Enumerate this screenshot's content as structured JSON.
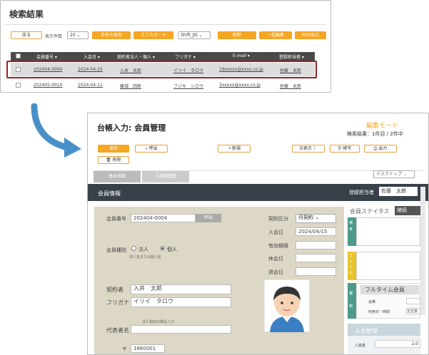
{
  "search": {
    "title": "検索結果",
    "back_label": "戻る",
    "count_label": "表示件数",
    "count_value": "20",
    "save_cond_label": "条件の保存",
    "export_label": "エクスポート",
    "encoding_value": "Shift_JIS",
    "delete_label": "削除",
    "bulk_edit_label": "一括編集",
    "pdf_label": "PDF出力",
    "columns": [
      "会員番号 ▾",
      "入会日 ▾",
      "契約者法人・個人 ▾",
      "フリガナ ▾",
      "E-mail ▾",
      "登録担当者 ▾"
    ],
    "rows": [
      [
        "202404-0004",
        "2024-04-15",
        "入井　太郎",
        "イリイ　タロウ",
        "19xxxxx@xxxx.co.jp",
        "佐藤　太郎"
      ],
      [
        "202405-0010",
        "2024-04-11",
        "藤城　四郎",
        "フジキ　シロウ",
        "3xxxxx@xxxx.co.jp",
        "佐藤　太郎"
      ]
    ]
  },
  "ledger": {
    "title": "台帳入力: 会員管理",
    "mode": "編集モード",
    "result_info": "検索結果：1件目 / 2件中",
    "buttons": {
      "save": "保存",
      "call": "呼出",
      "new": "＋新規",
      "next": "次表示 〉",
      "book": "帳写",
      "print": "出力",
      "delete": "削除"
    },
    "tabs": [
      "基本画面",
      "入退期履歴"
    ],
    "device": "デスクトップ",
    "section_title": "会員情報",
    "staff_label": "登録担当者",
    "staff_value": "佐藤　太郎",
    "member_no_label": "会員番号",
    "member_no_value": "202404-0004",
    "call_small": "呼出",
    "member_type_label": "会員種別",
    "type_corp": "法人",
    "type_indiv": "個人",
    "type_hint": "法人名または個人名",
    "contract_type_label": "契約区分",
    "contract_type_value": "月契約",
    "join_date_label": "入会日",
    "join_date_value": "2024/04/15",
    "valid_label": "有効期限",
    "leave_label": "休会日",
    "exit_label": "退会日",
    "contractor_label": "契約者",
    "contractor_value": "入井　太郎",
    "furigana_label": "フリガナ",
    "furigana_value": "イリイ　タロウ",
    "rep_hint": "法人契約の場合入力",
    "rep_label": "代表者名",
    "zip_label": "〒",
    "zip_value": "1660001",
    "status_label": "会員ステイタス",
    "status_value": "継続",
    "memo_label": "備考",
    "file_label": "ファイル",
    "kind_label": "種類",
    "plan_value": "フルタイム会員",
    "fee_label": "会費",
    "usage_label": "利用日・時間",
    "usage_value": "全営業",
    "payment_title": "入金管理",
    "payment_amount_label": "入金金",
    "payment_amount_value": "2,0"
  },
  "colors": {
    "accent": "#f5a623",
    "highlight": "#9b2025",
    "header_dark": "#38404a",
    "form_bg": "#ddd7c5",
    "arrow": "#4a90c8"
  }
}
